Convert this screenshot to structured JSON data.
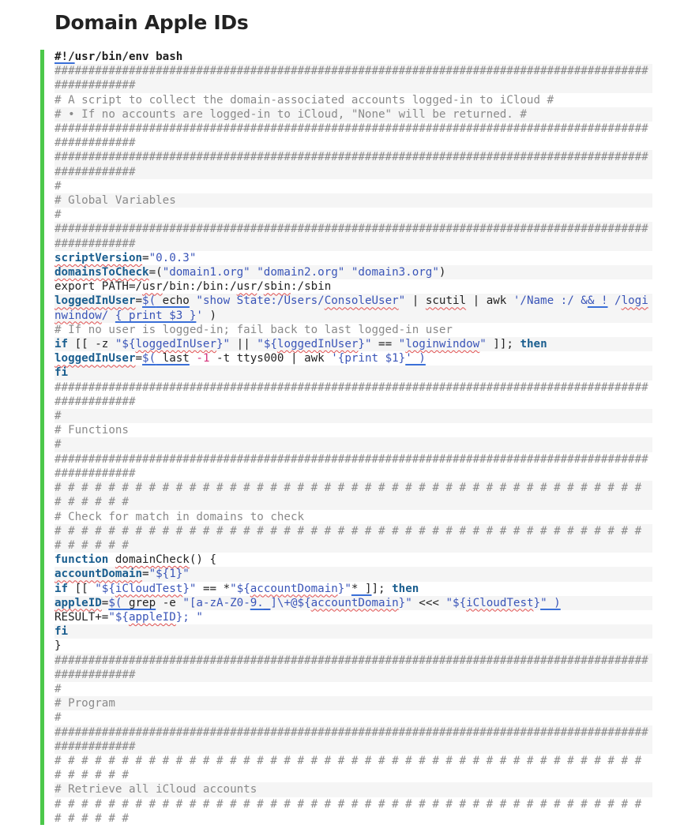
{
  "page": {
    "title": "Domain Apple IDs"
  },
  "colors": {
    "accent_bar": "#4cc84a",
    "stripe": "#f5f5f5",
    "comment": "#8a8a8a",
    "keyword": "#1a5e8f",
    "string": "#3a55b8",
    "number": "#d4317a"
  },
  "code": {
    "language": "bash",
    "lines": [
      [
        {
          "t": "#!/",
          "cls": "sb ul"
        },
        {
          "t": "usr/bin/env bash",
          "cls": "sb"
        }
      ],
      [
        {
          "t": "####################################################################################################",
          "cls": "c"
        }
      ],
      [
        {
          "t": "# A script to collect the domain-associated accounts logged-in to iCloud #",
          "cls": "c"
        }
      ],
      [
        {
          "t": "# • If no accounts are logged-in to iCloud, \"None\" will be returned. #",
          "cls": "c"
        }
      ],
      [
        {
          "t": "####################################################################################################",
          "cls": "c"
        }
      ],
      [
        {
          "t": "####################################################################################################",
          "cls": "c"
        }
      ],
      [
        {
          "t": "#",
          "cls": "c"
        }
      ],
      [
        {
          "t": "# Global Variables",
          "cls": "c"
        }
      ],
      [
        {
          "t": "#",
          "cls": "c"
        }
      ],
      [
        {
          "t": "####################################################################################################",
          "cls": "c"
        }
      ],
      [
        {
          "t": "scriptVersion",
          "cls": "v sq"
        },
        {
          "t": "=",
          "cls": ""
        },
        {
          "t": "\"0.0.3\"",
          "cls": "s"
        }
      ],
      [
        {
          "t": "domainsToCheck",
          "cls": "v sq"
        },
        {
          "t": "=(",
          "cls": ""
        },
        {
          "t": "\"domain1.org\" \"domain2.org\" \"domain3.org\"",
          "cls": "s"
        },
        {
          "t": ")",
          "cls": ""
        }
      ],
      [
        {
          "t": "export PATH=/",
          "cls": ""
        },
        {
          "t": "usr",
          "cls": "sq"
        },
        {
          "t": "/bin:/bin:/",
          "cls": ""
        },
        {
          "t": "usr",
          "cls": "sq"
        },
        {
          "t": "/",
          "cls": ""
        },
        {
          "t": "sbin",
          "cls": "sq"
        },
        {
          "t": ":/sbin",
          "cls": ""
        }
      ],
      [
        {
          "t": "loggedInUser",
          "cls": "v sq"
        },
        {
          "t": "=",
          "cls": ""
        },
        {
          "t": "$(",
          "cls": "s ul"
        },
        {
          "t": " echo",
          "cls": "ul"
        },
        {
          "t": " ",
          "cls": ""
        },
        {
          "t": "\"show State:/Users/",
          "cls": "s"
        },
        {
          "t": "ConsoleUser",
          "cls": "s sq"
        },
        {
          "t": "\"",
          "cls": "s"
        },
        {
          "t": " | ",
          "cls": ""
        },
        {
          "t": "scutil",
          "cls": "sq"
        },
        {
          "t": " | awk ",
          "cls": ""
        },
        {
          "t": "'/Name :/ &",
          "cls": "s"
        },
        {
          "t": "& !",
          "cls": "s ul"
        },
        {
          "t": " ",
          "cls": ""
        },
        {
          "t": "/",
          "cls": "s"
        },
        {
          "t": "loginwindow",
          "cls": "s sq"
        },
        {
          "t": "/ ",
          "cls": "s"
        },
        {
          "t": "{ print $3 }",
          "cls": "s ul"
        },
        {
          "t": "'",
          "cls": "s"
        },
        {
          "t": " )",
          "cls": ""
        }
      ],
      [
        {
          "t": "# If no user is logged-in; fail back to last logged-in user",
          "cls": "c"
        }
      ],
      [
        {
          "t": "if",
          "cls": "k"
        },
        {
          "t": " [[ -z ",
          "cls": ""
        },
        {
          "t": "\"${",
          "cls": "s"
        },
        {
          "t": "loggedInUser",
          "cls": "s sq"
        },
        {
          "t": "}\"",
          "cls": "s"
        },
        {
          "t": " || ",
          "cls": ""
        },
        {
          "t": "\"${",
          "cls": "s"
        },
        {
          "t": "loggedInUser",
          "cls": "s sq"
        },
        {
          "t": "}\"",
          "cls": "s"
        },
        {
          "t": " == ",
          "cls": ""
        },
        {
          "t": "\"",
          "cls": "s"
        },
        {
          "t": "loginwindow",
          "cls": "s sq"
        },
        {
          "t": "\"",
          "cls": "s"
        },
        {
          "t": " ]]; ",
          "cls": ""
        },
        {
          "t": "then",
          "cls": "k"
        }
      ],
      [
        {
          "t": "loggedInUser",
          "cls": "v sq"
        },
        {
          "t": "=",
          "cls": ""
        },
        {
          "t": "$(",
          "cls": "s ul"
        },
        {
          "t": " last",
          "cls": "ul"
        },
        {
          "t": " ",
          "cls": ""
        },
        {
          "t": "-1",
          "cls": "n"
        },
        {
          "t": " -t ttys000 | awk ",
          "cls": ""
        },
        {
          "t": "'{print $1}",
          "cls": "s"
        },
        {
          "t": "' )",
          "cls": "s ul"
        }
      ],
      [
        {
          "t": "fi",
          "cls": "k"
        }
      ],
      [
        {
          "t": "####################################################################################################",
          "cls": "c"
        }
      ],
      [
        {
          "t": "#",
          "cls": "c"
        }
      ],
      [
        {
          "t": "# Functions",
          "cls": "c"
        }
      ],
      [
        {
          "t": "#",
          "cls": "c"
        }
      ],
      [
        {
          "t": "####################################################################################################",
          "cls": "c"
        }
      ],
      [
        {
          "t": "# # # # # # # # # # # # # # # # # # # # # # # # # # # # # # # # # # # # # # # # # # # # # # # # # #",
          "cls": "c"
        }
      ],
      [
        {
          "t": "# Check for match in domains to check",
          "cls": "c"
        }
      ],
      [
        {
          "t": "# # # # # # # # # # # # # # # # # # # # # # # # # # # # # # # # # # # # # # # # # # # # # # # # # #",
          "cls": "c"
        }
      ],
      [
        {
          "t": "function",
          "cls": "k"
        },
        {
          "t": " ",
          "cls": ""
        },
        {
          "t": "domainCheck",
          "cls": "sq"
        },
        {
          "t": "() {",
          "cls": ""
        }
      ],
      [
        {
          "t": "accountDomain",
          "cls": "v sq"
        },
        {
          "t": "=",
          "cls": ""
        },
        {
          "t": "\"${1}\"",
          "cls": "s"
        }
      ],
      [
        {
          "t": "if",
          "cls": "k"
        },
        {
          "t": " [[ ",
          "cls": ""
        },
        {
          "t": "\"${",
          "cls": "s"
        },
        {
          "t": "iCloudTest",
          "cls": "s sq"
        },
        {
          "t": "}\"",
          "cls": "s"
        },
        {
          "t": " == *",
          "cls": ""
        },
        {
          "t": "\"${",
          "cls": "s"
        },
        {
          "t": "accountDomain",
          "cls": "s sq"
        },
        {
          "t": "}\"",
          "cls": "s"
        },
        {
          "t": "* ]",
          "cls": "ul"
        },
        {
          "t": "]; ",
          "cls": ""
        },
        {
          "t": "then",
          "cls": "k"
        }
      ],
      [
        {
          "t": "appleID",
          "cls": "v sq"
        },
        {
          "t": "=",
          "cls": ""
        },
        {
          "t": "$(",
          "cls": "s ul"
        },
        {
          "t": " grep",
          "cls": "ul"
        },
        {
          "t": " -e ",
          "cls": ""
        },
        {
          "t": "\"[a-zA-Z0-",
          "cls": "s"
        },
        {
          "t": "9._",
          "cls": "s ul"
        },
        {
          "t": "]\\+@${",
          "cls": "s"
        },
        {
          "t": "accountDomain",
          "cls": "s sq"
        },
        {
          "t": "}\"",
          "cls": "s"
        },
        {
          "t": " <<< ",
          "cls": ""
        },
        {
          "t": "\"${",
          "cls": "s"
        },
        {
          "t": "iCloudTest",
          "cls": "s sq"
        },
        {
          "t": "}",
          "cls": "s"
        },
        {
          "t": "\" )",
          "cls": "s ul"
        }
      ],
      [
        {
          "t": "RESULT+=",
          "cls": ""
        },
        {
          "t": "\"${",
          "cls": "s"
        },
        {
          "t": "appleID",
          "cls": "s sq"
        },
        {
          "t": "}; \"",
          "cls": "s"
        }
      ],
      [
        {
          "t": "fi",
          "cls": "k"
        }
      ],
      [
        {
          "t": "}",
          "cls": ""
        }
      ],
      [
        {
          "t": "####################################################################################################",
          "cls": "c"
        }
      ],
      [
        {
          "t": "#",
          "cls": "c"
        }
      ],
      [
        {
          "t": "# Program",
          "cls": "c"
        }
      ],
      [
        {
          "t": "#",
          "cls": "c"
        }
      ],
      [
        {
          "t": "####################################################################################################",
          "cls": "c"
        }
      ],
      [
        {
          "t": "# # # # # # # # # # # # # # # # # # # # # # # # # # # # # # # # # # # # # # # # # # # # # # # # # #",
          "cls": "c"
        }
      ],
      [
        {
          "t": "# Retrieve all iCloud accounts",
          "cls": "c"
        }
      ],
      [
        {
          "t": "# # # # # # # # # # # # # # # # # # # # # # # # # # # # # # # # # # # # # # # # # # # # # # # # # #",
          "cls": "c"
        }
      ]
    ]
  }
}
